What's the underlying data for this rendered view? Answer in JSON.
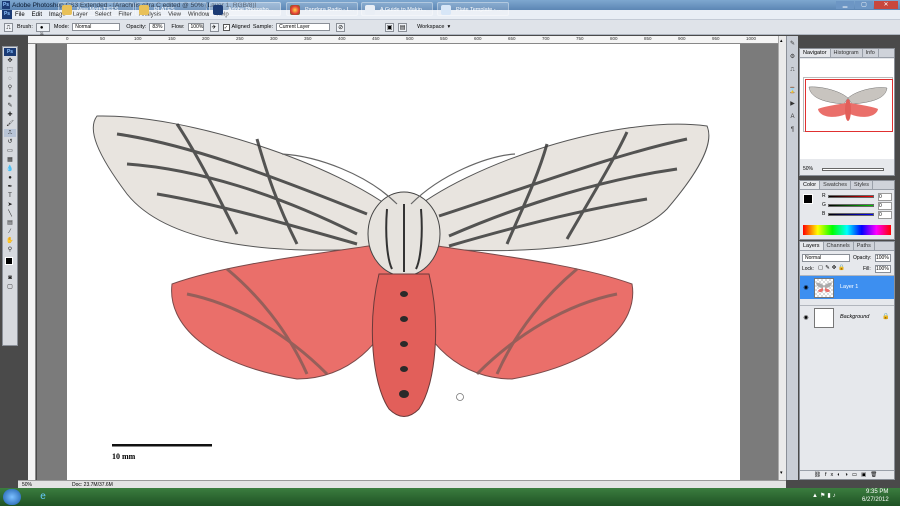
{
  "window": {
    "title": "Adobe Photoshop CS3 Extended - [Arachnis citra C edited @ 50% (Layer 1, RGB/8)]",
    "app_icon": "Ps"
  },
  "menu": [
    "File",
    "Edit",
    "Image",
    "Layer",
    "Select",
    "Filter",
    "Analysis",
    "View",
    "Window",
    "Help"
  ],
  "options": {
    "brush_label": "Brush:",
    "brush_size": "31",
    "mode_label": "Mode:",
    "mode_value": "Normal",
    "opacity_label": "Opacity:",
    "opacity_value": "83%",
    "flow_label": "Flow:",
    "flow_value": "100%",
    "aligned_label": "Aligned",
    "sample_label": "Sample:",
    "sample_value": "Current Layer",
    "workspace_label": "Workspace"
  },
  "ruler_top": [
    "0",
    "50",
    "100",
    "150",
    "200",
    "250",
    "300",
    "350",
    "400",
    "450",
    "500",
    "550",
    "600",
    "650",
    "700",
    "750",
    "800",
    "850",
    "900",
    "950",
    "1000",
    "1050"
  ],
  "canvas": {
    "scale_label": "10 mm"
  },
  "status": {
    "zoom": "50%",
    "doc": "Doc: 23.7M/37.6M"
  },
  "navigator": {
    "tabs": [
      "Navigator",
      "Histogram",
      "Info"
    ],
    "zoom": "50%"
  },
  "color": {
    "tabs": [
      "Color",
      "Swatches",
      "Styles"
    ],
    "channels": [
      {
        "label": "R",
        "value": "0"
      },
      {
        "label": "G",
        "value": "0"
      },
      {
        "label": "B",
        "value": "0"
      }
    ]
  },
  "layers": {
    "tabs": [
      "Layers",
      "Channels",
      "Paths"
    ],
    "blend_mode": "Normal",
    "opacity_label": "Opacity:",
    "opacity": "100%",
    "lock_label": "Lock:",
    "fill_label": "Fill:",
    "fill": "100%",
    "items": [
      {
        "name": "Layer 1"
      },
      {
        "name": "Background"
      }
    ]
  },
  "taskbar": {
    "items": [
      "New Moth TIFFS",
      "PLATES",
      "Adobe Photosho...",
      "Pandora Radio - L...",
      "A Guide to Makin...",
      "Plate Template - ..."
    ],
    "time": "9:35 PM",
    "date": "6/27/2012"
  },
  "colors": {
    "selected_layer": "#3d8ff0",
    "taskbar": "#2b6a30",
    "hindwing": "#ea6f6a"
  }
}
